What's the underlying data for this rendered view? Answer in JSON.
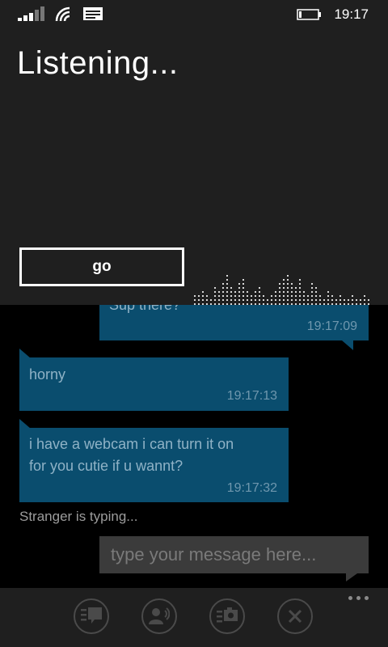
{
  "status_bar": {
    "time": "19:17",
    "icons": [
      "signal-strength-icon",
      "wifi-icon",
      "message-notification-icon",
      "battery-icon"
    ]
  },
  "listening": {
    "title": "Listening...",
    "go_label": "go"
  },
  "chat": {
    "partial_message": {
      "text": "Sup there?",
      "time": "19:17:09"
    },
    "messages": [
      {
        "text": "horny",
        "time": "19:17:13"
      },
      {
        "line1": "i have a webcam i can turn it on",
        "line2": "for you cutie if u wannt?",
        "time": "19:17:32"
      }
    ],
    "typing_status": "Stranger is typing...",
    "input_placeholder": "type your message here..."
  },
  "app_bar": {
    "buttons": [
      "new-chat-icon",
      "voice-input-icon",
      "send-photo-icon",
      "close-icon"
    ],
    "more_icon": "more-options-icon"
  },
  "colors": {
    "bubble": "#0a4d6e",
    "panel": "#1f1f1f",
    "background": "#000000"
  }
}
